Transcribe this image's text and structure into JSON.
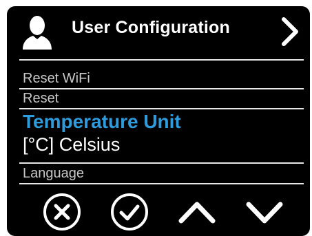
{
  "header": {
    "title": "User Configuration",
    "user_icon": "user-icon",
    "next_icon": "chevron-right-icon"
  },
  "menu": {
    "items": [
      {
        "label": "Reset WiFi"
      },
      {
        "label": "Reset"
      }
    ],
    "selected": {
      "label": "Temperature Unit",
      "value": "[°C]  Celsius"
    },
    "after": [
      {
        "label": "Language"
      }
    ]
  },
  "footer": {
    "buttons": [
      {
        "icon": "cancel-icon"
      },
      {
        "icon": "confirm-icon"
      },
      {
        "icon": "arrow-up-icon"
      },
      {
        "icon": "arrow-down-icon"
      }
    ]
  },
  "colors": {
    "background": "#000000",
    "text": "#ffffff",
    "muted_text": "#c8c8c8",
    "accent": "#2d9bdc"
  }
}
